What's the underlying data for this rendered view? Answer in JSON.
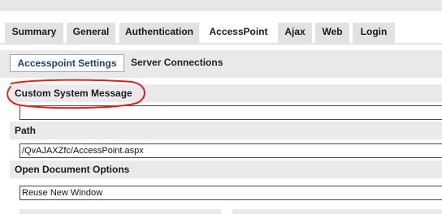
{
  "tabs": [
    {
      "label": "Summary",
      "active": false
    },
    {
      "label": "General",
      "active": false
    },
    {
      "label": "Authentication",
      "active": false
    },
    {
      "label": "AccessPoint",
      "active": true
    },
    {
      "label": "Ajax",
      "active": false
    },
    {
      "label": "Web",
      "active": false
    },
    {
      "label": "Login",
      "active": false
    }
  ],
  "subtabs": [
    {
      "label": "Accesspoint Settings",
      "active": true
    },
    {
      "label": "Server Connections",
      "active": false
    }
  ],
  "sections": {
    "custom_message": {
      "label": "Custom System Message",
      "value": ""
    },
    "path": {
      "label": "Path",
      "value": "/QvAJAXZfc/AccessPoint.aspx"
    },
    "open_document": {
      "label": "Open Document Options",
      "value": "Reuse New Window"
    }
  },
  "colors": {
    "annotation_red": "#e0201c",
    "active_subtab_text": "#1f3f7a",
    "section_bg": "#ece9ec",
    "tab_bg": "#e2e2e2"
  }
}
